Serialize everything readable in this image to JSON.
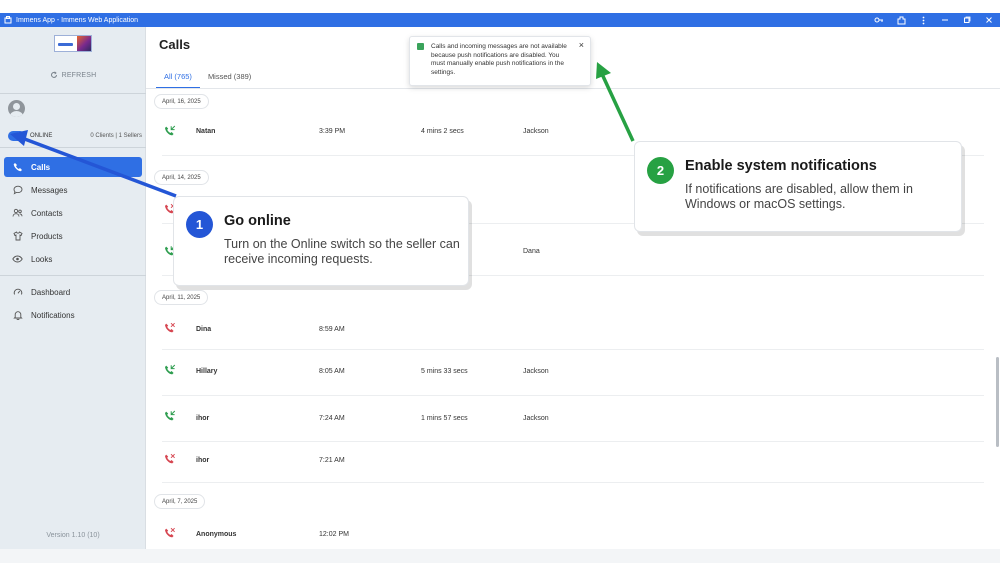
{
  "window": {
    "title": "Immens App - Immens Web Application",
    "controls": [
      "key-icon",
      "extension-icon",
      "more-icon",
      "minimize-icon",
      "restore-icon",
      "close-icon"
    ]
  },
  "sidebar": {
    "refresh_label": "REFRESH",
    "status_label": "ONLINE",
    "status_counts": "0 Clients | 1 Sellers",
    "nav": [
      {
        "label": "Calls",
        "icon": "phone-icon",
        "active": true
      },
      {
        "label": "Messages",
        "icon": "chat-icon"
      },
      {
        "label": "Contacts",
        "icon": "contacts-icon"
      },
      {
        "label": "Products",
        "icon": "shirt-icon"
      },
      {
        "label": "Looks",
        "icon": "eye-icon"
      },
      {
        "label": "Dashboard",
        "icon": "gauge-icon"
      },
      {
        "label": "Notifications",
        "icon": "bell-icon"
      }
    ],
    "version": "Version 1.10 (10)"
  },
  "main": {
    "title": "Calls",
    "tabs": [
      {
        "label": "All (765)",
        "active": true
      },
      {
        "label": "Missed (389)"
      }
    ],
    "dates": [
      "April, 16, 2025",
      "April, 14, 2025",
      "April, 11, 2025",
      "April, 7, 2025"
    ],
    "calls": [
      {
        "name": "Natan",
        "time": "3:39 PM",
        "duration": "4 mins 2 secs",
        "agent": "Jackson",
        "status": "answered"
      },
      {
        "name": "",
        "time": "",
        "duration": "",
        "agent": "",
        "status": "missed"
      },
      {
        "name": "",
        "time": "",
        "duration": "",
        "agent": "Dana",
        "status": "answered"
      },
      {
        "name": "Dina",
        "time": "8:59 AM",
        "duration": "",
        "agent": "",
        "status": "missed"
      },
      {
        "name": "Hillary",
        "time": "8:05 AM",
        "duration": "5 mins 33 secs",
        "agent": "Jackson",
        "status": "answered"
      },
      {
        "name": "ihor",
        "time": "7:24 AM",
        "duration": "1 mins 57 secs",
        "agent": "Jackson",
        "status": "answered"
      },
      {
        "name": "ihor",
        "time": "7:21 AM",
        "duration": "",
        "agent": "",
        "status": "missed"
      },
      {
        "name": "Anonymous",
        "time": "12:02 PM",
        "duration": "",
        "agent": "",
        "status": "missed"
      }
    ]
  },
  "toast": {
    "text": "Calls and incoming messages are not available because push notifications are disabled. You must manually enable push notifications in the settings.",
    "close": "×"
  },
  "callouts": [
    {
      "number": "1",
      "title": "Go online",
      "text": "Turn on the Online switch so the seller can receive incoming requests.",
      "color": "#2456d6"
    },
    {
      "number": "2",
      "title": "Enable system notifications",
      "text": "If notifications are disabled, allow them in Windows or macOS settings.",
      "color": "#27a143"
    }
  ],
  "colors": {
    "accent": "#2f6fe4",
    "answered": "#2e9d4f",
    "missed": "#d64550"
  }
}
